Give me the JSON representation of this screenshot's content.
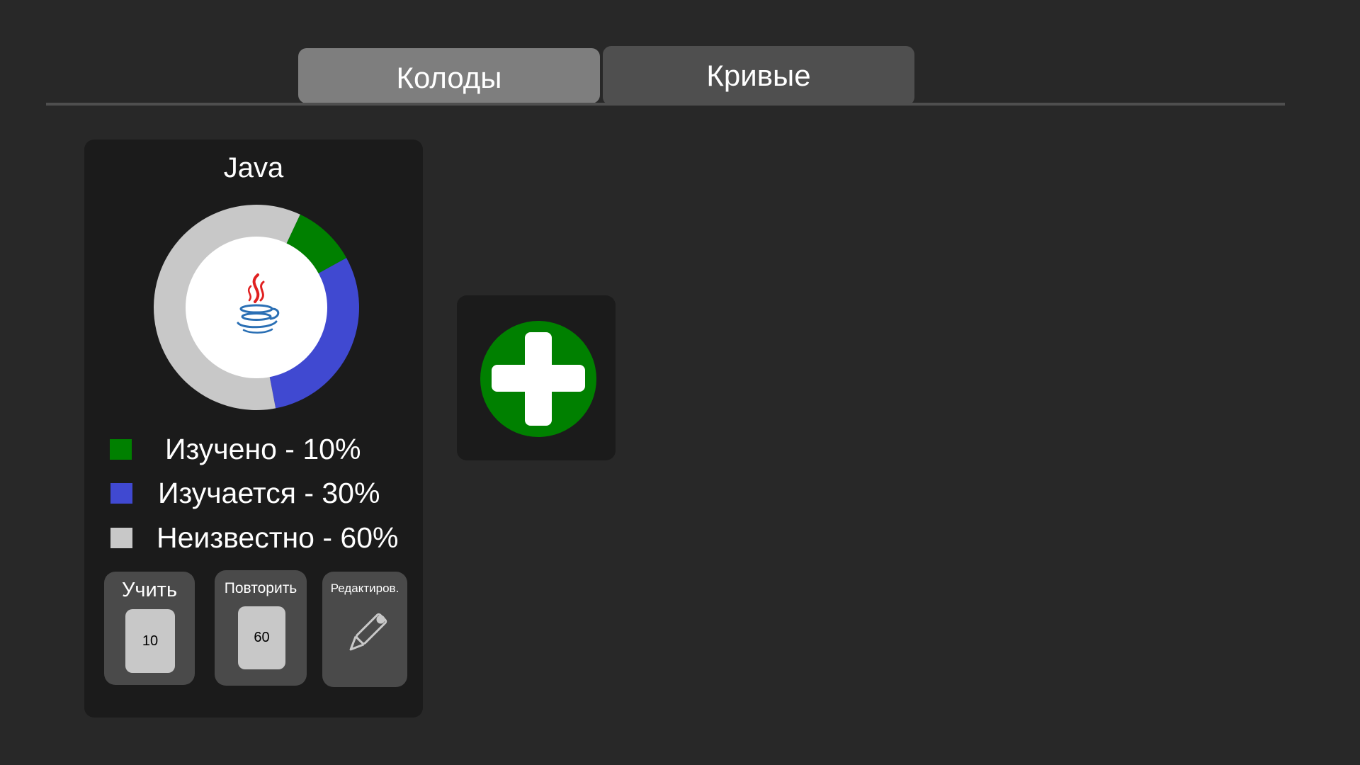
{
  "tabs": [
    {
      "label": "Колоды",
      "active": true
    },
    {
      "label": "Кривые",
      "active": false
    }
  ],
  "deck": {
    "title": "Java",
    "icon": "java-logo-icon",
    "chart_data": {
      "type": "pie",
      "categories": [
        "Изучено",
        "Изучается",
        "Неизвестно"
      ],
      "values": [
        10,
        30,
        60
      ],
      "colors": [
        "#008000",
        "#4049d1",
        "#c8c8c8"
      ]
    },
    "legend": [
      {
        "text": "Изучено - 10%",
        "color": "#008000"
      },
      {
        "text": "Изучается - 30%",
        "color": "#4049d1"
      },
      {
        "text": "Неизвестно - 60%",
        "color": "#c8c8c8"
      }
    ],
    "actions": {
      "learn": {
        "label": "Учить",
        "count": "10"
      },
      "review": {
        "label": "Повторить",
        "count": "60"
      },
      "edit": {
        "label": "Редактиров.",
        "icon": "pencil-icon"
      }
    }
  },
  "add_deck": {
    "icon": "plus-icon",
    "color": "#008000"
  },
  "colors": {
    "background": "#282828",
    "card": "#1b1b1b",
    "tab_active": "#7e7e7e",
    "tab_inactive": "#4f4f4f"
  }
}
